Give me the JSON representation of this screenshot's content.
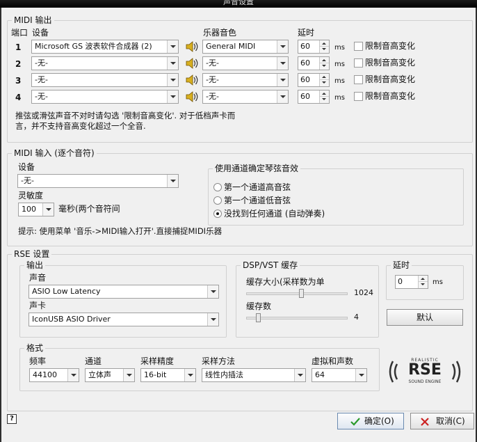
{
  "window": {
    "title": "声音设置"
  },
  "midi_out": {
    "legend": "MIDI 输出",
    "col_port": "端口",
    "col_device": "设备",
    "col_instrument": "乐器音色",
    "col_delay": "延时",
    "delay_unit": "ms",
    "limit_label": "限制音高变化",
    "rows": [
      {
        "port": "1",
        "device": "Microsoft GS 波表软件合成器 (2)",
        "instrument": "General MIDI",
        "delay": "60"
      },
      {
        "port": "2",
        "device": "-无-",
        "instrument": "-无-",
        "delay": "60"
      },
      {
        "port": "3",
        "device": "-无-",
        "instrument": "-无-",
        "delay": "60"
      },
      {
        "port": "4",
        "device": "-无-",
        "instrument": "-无-",
        "delay": "60"
      }
    ],
    "note_line1": "推弦或滑弦声音不对时请勾选 '限制音高变化'. 对于低档声卡而",
    "note_line2": "言，并不支持音高变化超过一个全音."
  },
  "midi_in": {
    "legend": "MIDI 输入 (逐个音符)",
    "device_label": "设备",
    "device_value": "-无-",
    "sensitivity_label": "灵敏度",
    "sensitivity_value": "100",
    "sensitivity_unit": "毫秒(两个音符间",
    "channel_legend": "使用通道确定琴弦音效",
    "radios": [
      {
        "label": "第一个通道高音弦",
        "selected": false
      },
      {
        "label": "第一个通道低音弦",
        "selected": false
      },
      {
        "label": "没找到任何通道 (自动弹奏)",
        "selected": true
      }
    ],
    "hint": "提示: 使用菜单 '音乐->MIDI输入打开'.直接捕捉MIDI乐器"
  },
  "rse": {
    "legend": "RSE 设置",
    "output_legend": "输出",
    "sound_label": "声音",
    "sound_value": "ASIO Low Latency",
    "card_label": "声卡",
    "card_value": "IconUSB ASIO Driver",
    "dsp_legend": "DSP/VST 缓存",
    "buffer_size_label": "缓存大小(采样数为单",
    "buffer_size_value": "1024",
    "buffer_size_level": 0.55,
    "buffer_count_label": "缓存数",
    "buffer_count_value": "4",
    "buffer_count_level": 0.1,
    "delay_legend": "延时",
    "delay_value": "0",
    "delay_unit": "ms",
    "default_button": "默认",
    "format_legend": "格式",
    "freq_label": "频率",
    "freq_value": "44100",
    "channel_label": "通道",
    "channel_value": "立体声",
    "precision_label": "采样精度",
    "precision_value": "16-bit",
    "method_label": "采样方法",
    "method_value": "线性内插法",
    "virtual_label": "虚拟和声数",
    "virtual_value": "64",
    "logo_top": "REALISTIC",
    "logo_main": "RSE",
    "logo_bottom": "SOUND ENGINE"
  },
  "footer": {
    "help_glyph": "?",
    "ok_label": "确定(O)",
    "cancel_label": "取消(C)"
  },
  "colors": {
    "ok_check": "#2a9a2a",
    "cancel_x": "#cc2222"
  }
}
